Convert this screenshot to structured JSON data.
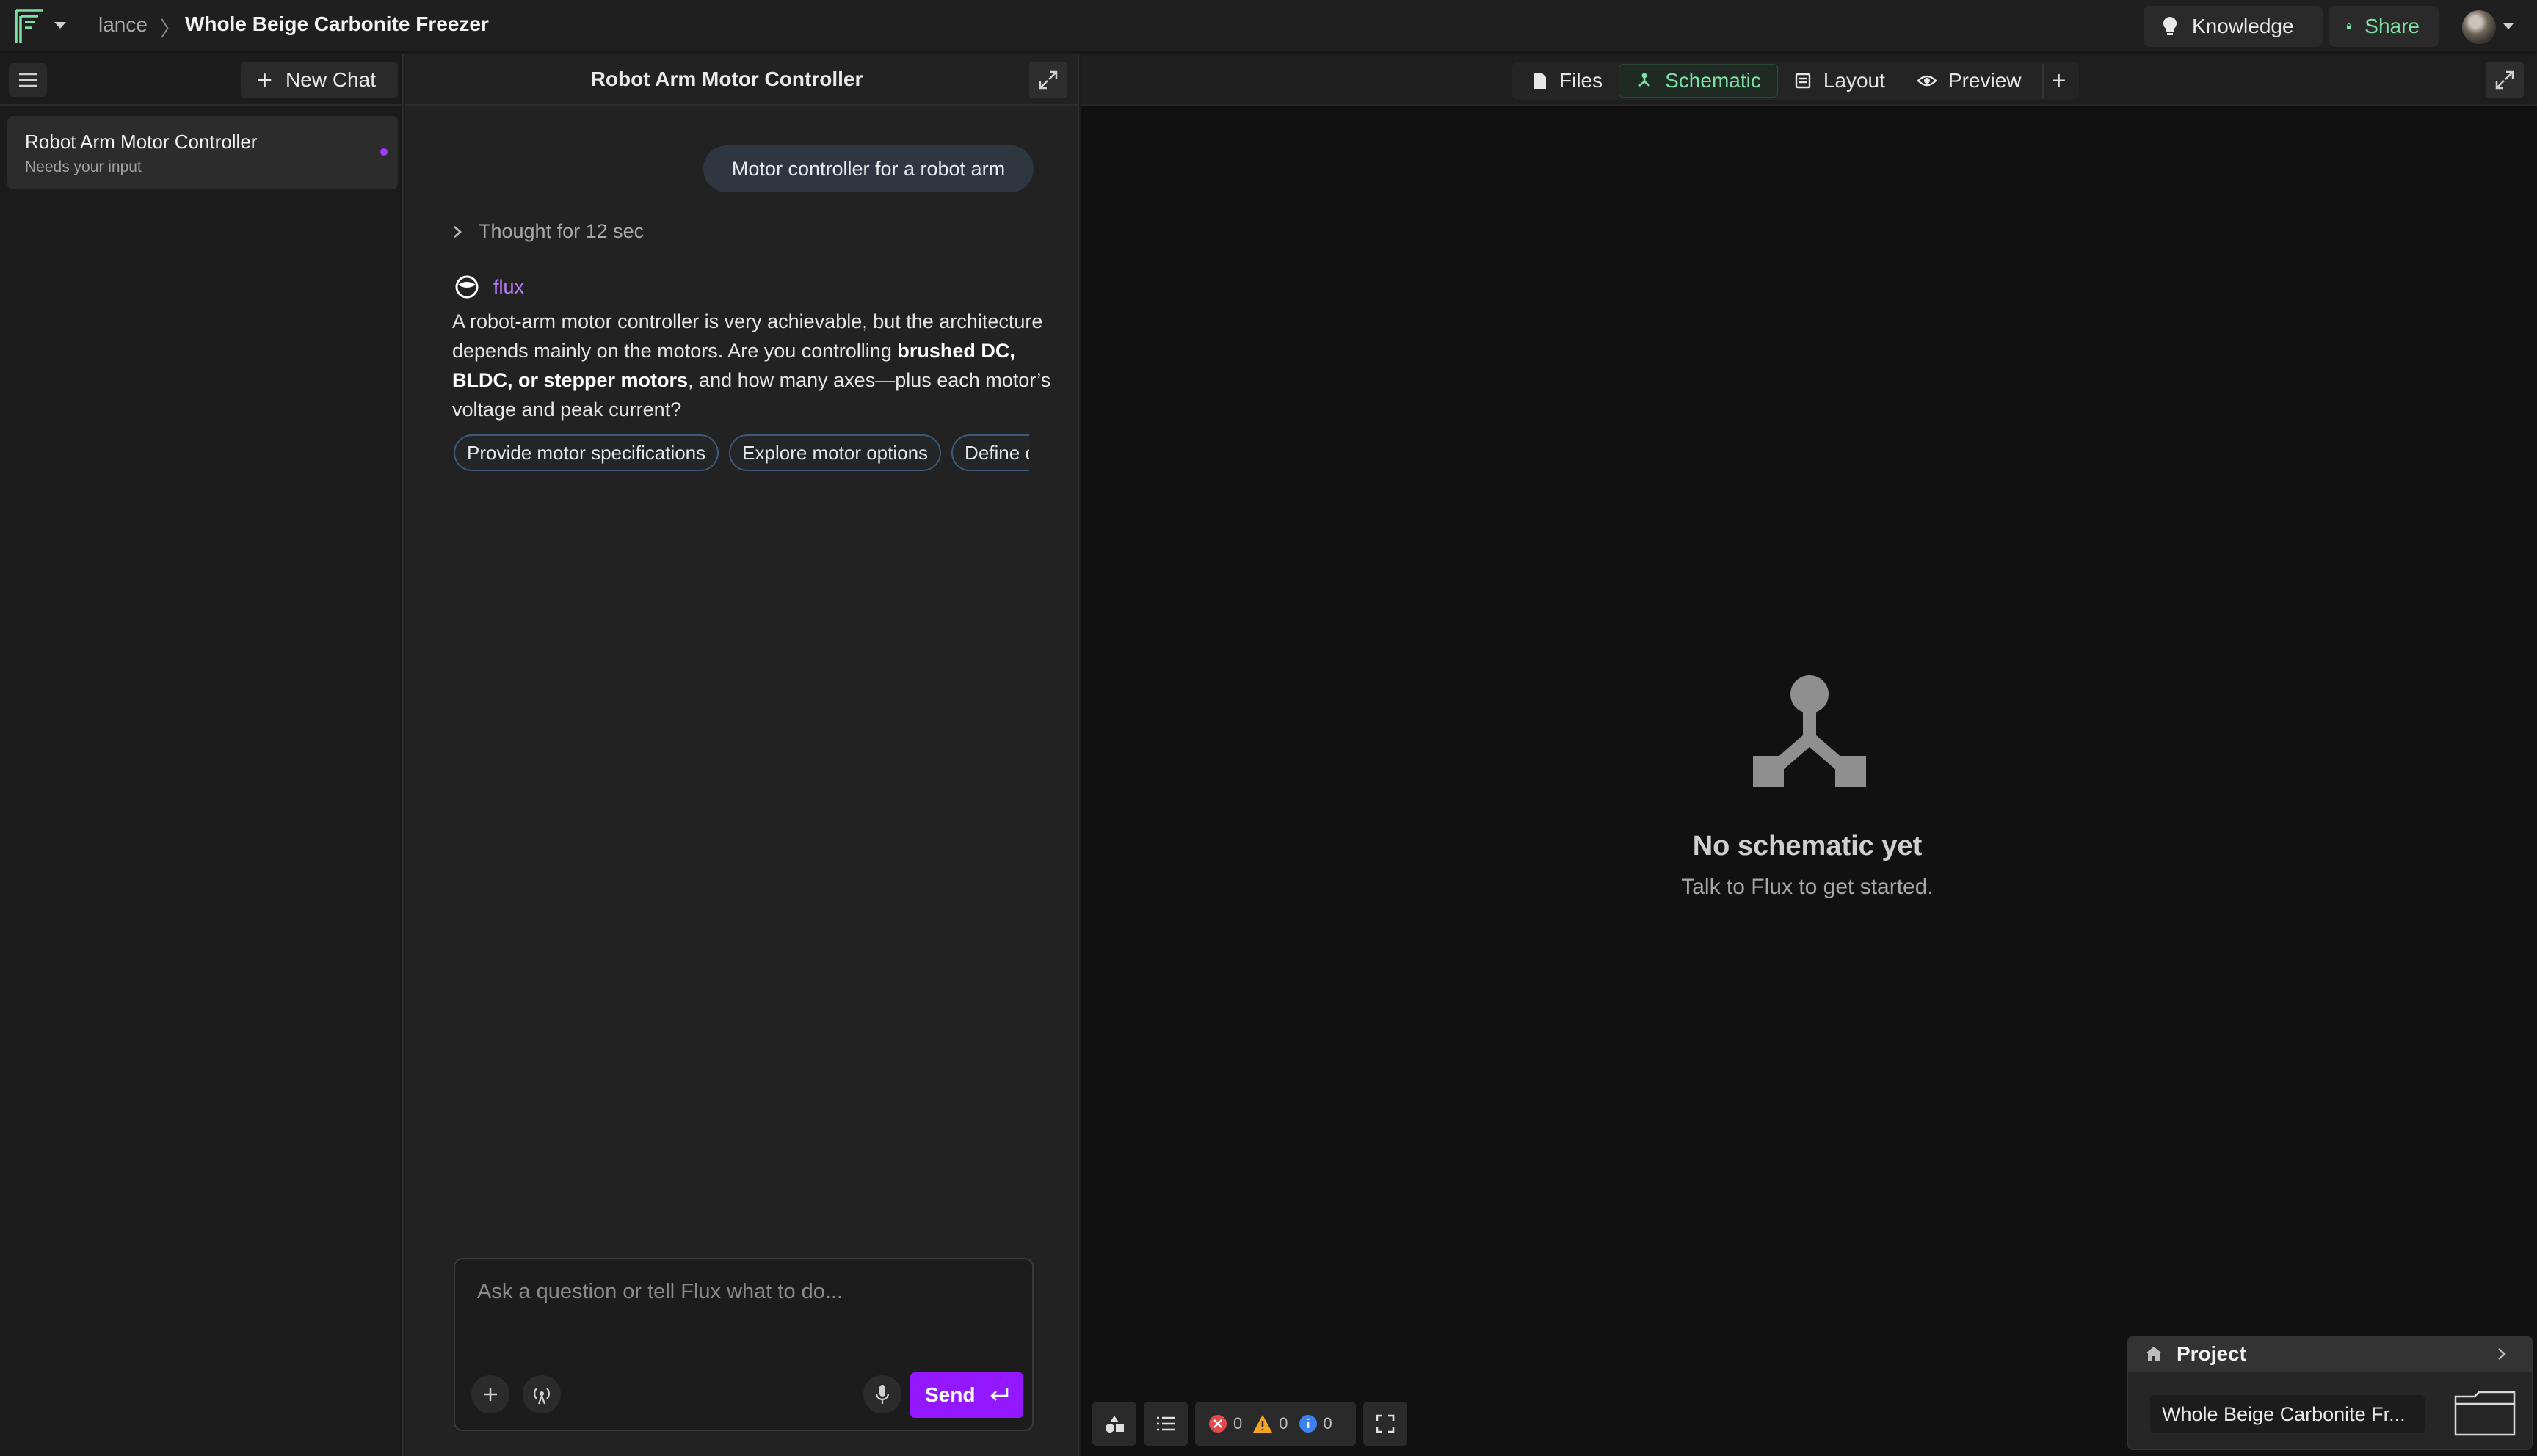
{
  "header": {
    "user": "lance",
    "separator": "〉",
    "project": "Whole Beige Carbonite Freezer",
    "knowledge_label": "Knowledge",
    "share_label": "Share"
  },
  "sidebar": {
    "new_chat_label": "New Chat",
    "items": [
      {
        "title": "Robot Arm Motor Controller",
        "subtitle": "Needs your input"
      }
    ]
  },
  "chat": {
    "title": "Robot Arm Motor Controller",
    "user_message": "Motor controller for a robot arm",
    "thought": "Thought for 12 sec",
    "assistant_name": "flux",
    "answer": {
      "part1": "A robot-arm motor controller is very achievable, but the architecture depends mainly on the motors. Are you controlling ",
      "bold": "brushed DC, BLDC, or stepper motors",
      "part2": ", and how many axes—plus each motor’s voltage and peak current?"
    },
    "suggestions": [
      "Provide motor specifications",
      "Explore motor options",
      "Define control"
    ],
    "composer_placeholder": "Ask a question or tell Flux what to do...",
    "send_label": "Send"
  },
  "canvas": {
    "tabs": [
      {
        "label": "Files",
        "active": false
      },
      {
        "label": "Schematic",
        "active": true
      },
      {
        "label": "Layout",
        "active": false
      },
      {
        "label": "Preview",
        "active": false
      }
    ],
    "add_tab": "+",
    "empty_title": "No schematic yet",
    "empty_subtitle": "Talk to Flux to get started.",
    "status": {
      "errors": "0",
      "warnings": "0",
      "info": "0"
    },
    "project_card": {
      "heading": "Project",
      "name": "Whole Beige Carbonite Fr..."
    }
  },
  "colors": {
    "accent_purple": "#9418ff",
    "accent_green": "#7fe0a6",
    "error": "#e5484d",
    "warning": "#f5a524",
    "info": "#3b82f6"
  },
  "icons": [
    "flux-logo-icon",
    "caret-down-icon",
    "lightbulb-icon",
    "lock-icon",
    "menu-icon",
    "plus-icon",
    "expand-icon",
    "chevron-right-icon",
    "flux-assistant-icon",
    "file-icon",
    "schematic-icon",
    "layout-icon",
    "eye-icon",
    "antenna-icon",
    "microphone-icon",
    "enter-icon",
    "home-icon",
    "list-icon",
    "shapes-icon",
    "fullscreen-icon",
    "folder-icon"
  ]
}
